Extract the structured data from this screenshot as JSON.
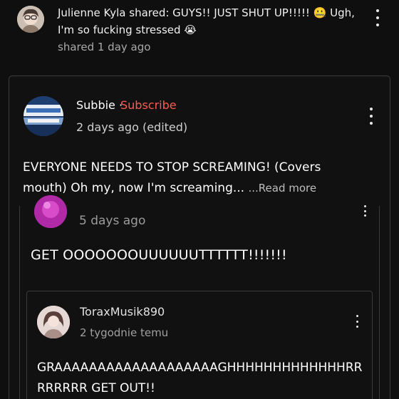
{
  "notification": {
    "text": "Julienne Kyla shared: GUYS!! JUST SHUT UP!!!!! 🤐 Ugh, I'm so fucking stressed 😭",
    "time": "shared 1 day ago"
  },
  "post": {
    "channel_name": "Subbie",
    "separator": " · ",
    "subscribe_label": "Subscribe",
    "date": "2 days ago (edited)",
    "text": "EVERYONE NEEDS TO STOP SCREAMING! (Covers mouth) Oh my, now I'm screaming... ",
    "read_more_label": "...Read more"
  },
  "embedded": {
    "comment_time": "5 days ago",
    "comment_text": "GET OOOOOOOUUUUUUTTTTTT!!!!!!!",
    "reply": {
      "username": "ToraxMusik890",
      "time": "2 tygodnie temu",
      "text": "GRAAAAAAAAAAAAAAAAAAAGHHHHHHHHHHHHHRRRRRRRR GET OUT!!"
    }
  },
  "icons": {
    "more": "more-vert-icon"
  },
  "colors": {
    "background": "#0f0f0f",
    "subscribe": "#ff5a52",
    "secondary_text": "#a9a9a9"
  }
}
